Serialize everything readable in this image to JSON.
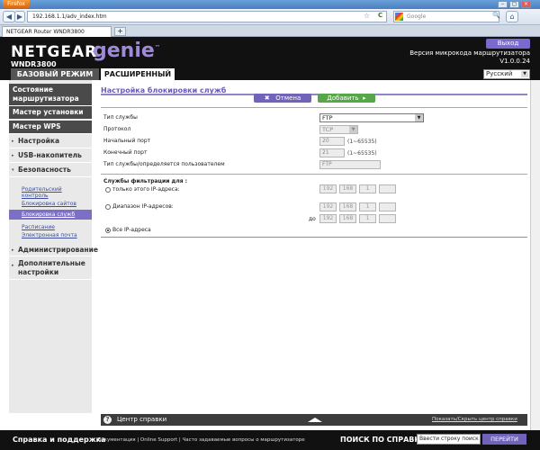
{
  "browser": {
    "app_button": "Firefox",
    "url": "192.168.1.1/adv_index.htm",
    "search_placeholder": "Google",
    "tab_title": "NETGEAR Router WNDR3800",
    "new_tab": "+",
    "back": "◀",
    "forward": "▶",
    "star": "☆",
    "reload": "C",
    "search_go": "🔍",
    "home": "⌂",
    "win_min": "–",
    "win_max": "▢",
    "win_close": "×"
  },
  "header": {
    "brand": "NETGEAR",
    "genie": "genie",
    "tm": "™",
    "model": "WNDR3800",
    "logout": "Выход",
    "fw_label": "Версия микрокода маршрутизатора",
    "fw_version": "V1.0.0.24",
    "mode_basic": "БАЗОВЫЙ РЕЖИМ",
    "mode_advanced": "РАСШИРЕННЫЙ",
    "language": "Русский"
  },
  "sidebar": {
    "status": "Состояние маршрутизатора",
    "setup_wizard": "Мастер установки",
    "wps_wizard": "Мастер WPS",
    "settings": "Настройка",
    "usb": "USB-накопитель",
    "security": "Безопасность",
    "parental": "Родительский контроль",
    "block_sites": "Блокировка сайтов",
    "block_services": "Блокировка служб",
    "schedule": "Расписание",
    "email": "Электронная почта",
    "admin": "Администрирование",
    "advanced_settings": "Дополнительные настройки",
    "tri": "▸",
    "tri_open": "▾"
  },
  "main": {
    "title": "Настройка блокировки служб",
    "cancel": "Отмена",
    "add": "Добавить",
    "cancel_icon": "✖",
    "add_icon": "▸",
    "service_type_label": "Тип службы",
    "service_type_value": "FTP",
    "protocol_label": "Протокол",
    "protocol_value": "TCP",
    "start_port_label": "Начальный порт",
    "start_port_value": "20",
    "start_port_hint": "(1~65535)",
    "end_port_label": "Конечный порт",
    "end_port_value": "21",
    "end_port_hint": "(1~65535)",
    "user_defined_label": "Тип службы/определяется пользователем",
    "user_defined_value": "FTP",
    "filter_title": "Службы фильтрации для :",
    "only_ip_label": "только этого IP-адреса:",
    "range_label": "Диапазон IP-адресов:",
    "to_label": "до",
    "all_ip_label": "Все IP-адреса",
    "ip_only": [
      "192",
      "168",
      "1",
      ""
    ],
    "ip_range_from": [
      "192",
      "168",
      "1",
      ""
    ],
    "ip_range_to": [
      "192",
      "168",
      "1",
      ""
    ]
  },
  "help": {
    "title": "Центр справки",
    "icon": "?",
    "toggle_link": "Показать/Скрыть центр справки"
  },
  "footer": {
    "support": "Справка и поддержка",
    "docs": "Документация | Online Support | Часто задаваемые вопросы о маршрутизаторе",
    "search_label": "ПОИСК ПО СПРАВКЕ",
    "search_value": "Ввести строку поиск",
    "go": "ПЕРЕЙТИ"
  },
  "colors": {
    "accent_purple": "#6f64b8",
    "add_green": "#58a64a",
    "header_black": "#111111"
  }
}
